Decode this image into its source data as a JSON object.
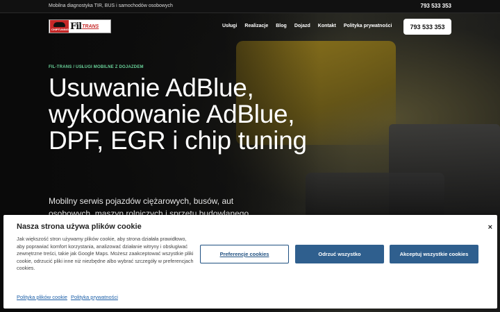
{
  "topbar": {
    "tagline": "Mobilna diagnostyka TIR, BUS i samochodów osobowych",
    "phone": "793 533 353"
  },
  "logo": {
    "chip_text": "CHIPTUNING",
    "name_fil": "Fil",
    "name_trans": "TRANS"
  },
  "nav": {
    "items": [
      "Usługi",
      "Realizacje",
      "Blog",
      "Dojazd",
      "Kontakt",
      "Polityka prywatności"
    ],
    "call_button": "793 533 353"
  },
  "hero": {
    "breadcrumb": "FIL-TRANS / USŁUGI MOBILNE Z DOJAZDEM",
    "headline": "Usuwanie AdBlue, wykodowanie AdBlue, DPF, EGR i chip tuning",
    "subtitle": "Mobilny serwis pojazdów ciężarowych, busów, aut osobowych, maszyn rolniczych i sprzętu budowlanego.",
    "peek_1": "...",
    "peek_2": "..."
  },
  "cookie": {
    "title": "Nasza strona używa plików cookie",
    "text": "Jak większość stron używamy plików cookie, aby strona działała prawidłowo, aby poprawiać komfort korzystania, analizować działanie witryny i obsługiwać zewnętrzne treści, takie jak Google Maps. Możesz zaakceptować wszystkie pliki cookie, odrzucić pliki inne niż niezbędne albo wybrać szczegóły w preferencjach cookies.",
    "btn_preferences": "Preferencje cookies",
    "btn_deny": "Odrzuć wszystko",
    "btn_accept": "Akceptuj wszystkie cookies",
    "link_cookies": "Polityka plików cookie",
    "link_privacy": "Polityka prywatności",
    "close_glyph": "×"
  },
  "colors": {
    "accent_green": "#69d39a",
    "button_blue": "#2f5f8e",
    "link_blue": "#1c5fa8",
    "brand_red": "#c62828"
  }
}
